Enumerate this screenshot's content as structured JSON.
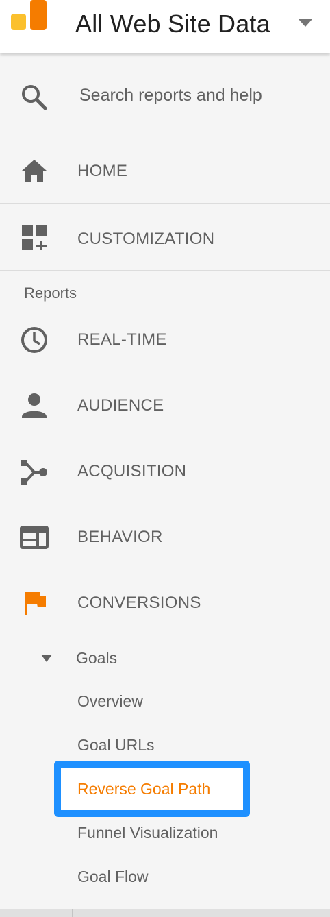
{
  "header": {
    "property_title": "All Web Site Data",
    "logo": "analytics-logo-icon",
    "caret": "dropdown-caret-icon"
  },
  "search": {
    "placeholder": "Search reports and help",
    "icon": "search-icon"
  },
  "nav": {
    "home": {
      "label": "HOME",
      "icon": "home-icon"
    },
    "customization": {
      "label": "CUSTOMIZATION",
      "icon": "dashboard-add-icon"
    }
  },
  "reports": {
    "section_label": "Reports",
    "items": [
      {
        "label": "REAL-TIME",
        "icon": "clock-icon"
      },
      {
        "label": "AUDIENCE",
        "icon": "person-icon"
      },
      {
        "label": "ACQUISITION",
        "icon": "acquisition-icon"
      },
      {
        "label": "BEHAVIOR",
        "icon": "behavior-icon"
      },
      {
        "label": "CONVERSIONS",
        "icon": "flag-icon"
      }
    ]
  },
  "goals": {
    "label": "Goals",
    "items": [
      {
        "label": "Overview",
        "active": false
      },
      {
        "label": "Goal URLs",
        "active": false
      },
      {
        "label": "Reverse Goal Path",
        "active": true
      },
      {
        "label": "Funnel Visualization",
        "active": false
      },
      {
        "label": "Goal Flow",
        "active": false
      }
    ]
  },
  "colors": {
    "active_text": "#f57c00",
    "highlight_border": "#1e90ff",
    "icon_gray": "#616161",
    "conversions_flag": "#f57c00",
    "logo_orange": "#f57c00",
    "logo_yellow": "#fbc02d"
  }
}
